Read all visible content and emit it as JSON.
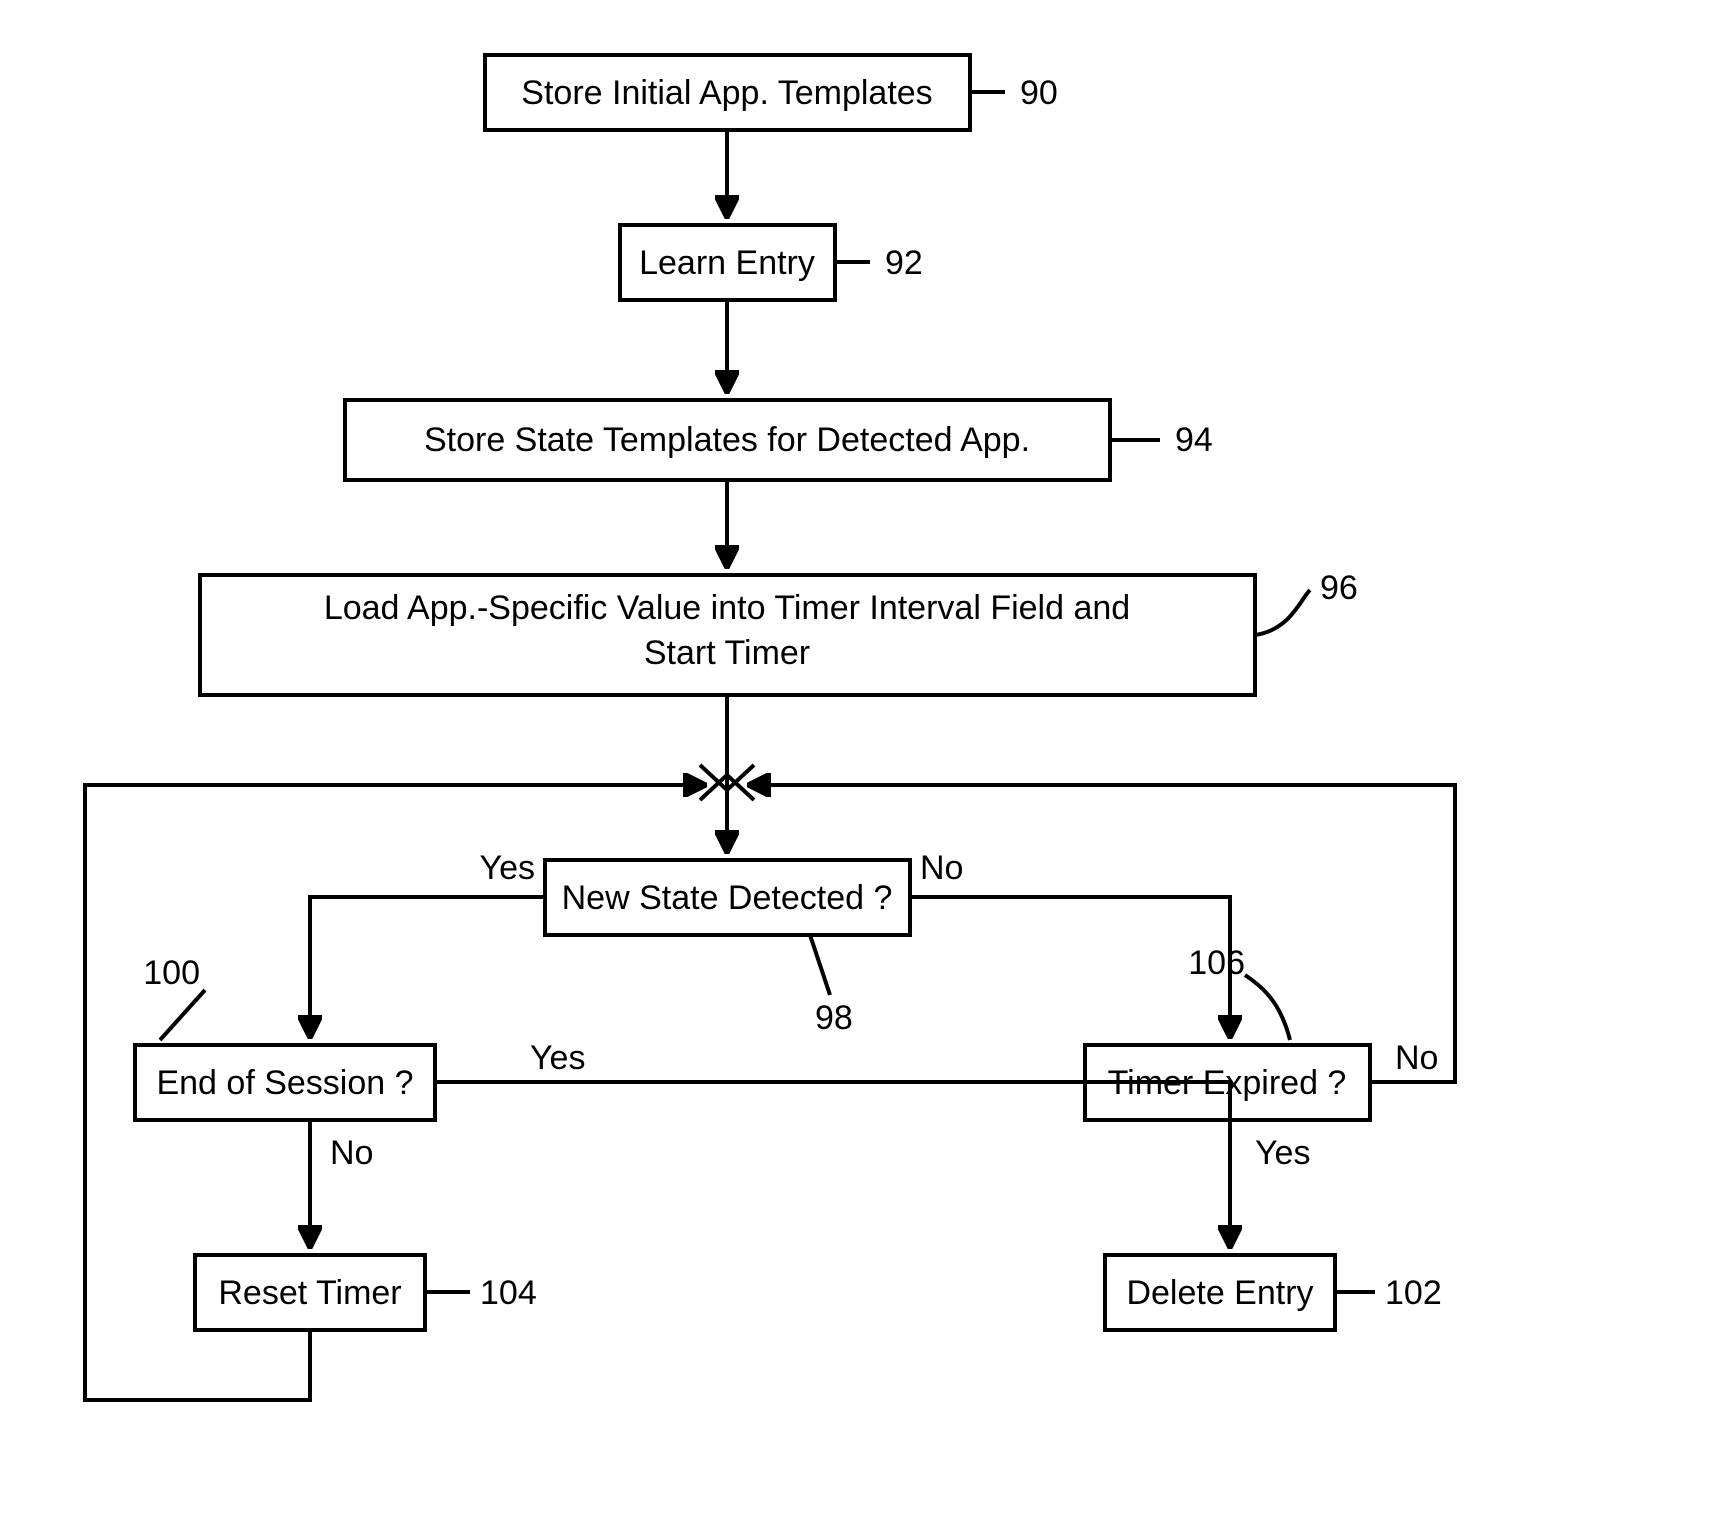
{
  "flowchart": {
    "boxes": {
      "b90": {
        "label": "Store Initial App. Templates",
        "ref": "90"
      },
      "b92": {
        "label": "Learn Entry",
        "ref": "92"
      },
      "b94": {
        "label": "Store State Templates for Detected App.",
        "ref": "94"
      },
      "b96": {
        "line1": "Load App.-Specific Value into Timer Interval Field and",
        "line2": "Start Timer",
        "ref": "96"
      },
      "b98": {
        "label": "New State Detected ?",
        "ref": "98"
      },
      "b100": {
        "label": "End of Session ?",
        "ref": "100"
      },
      "b102": {
        "label": "Delete Entry",
        "ref": "102"
      },
      "b104": {
        "label": "Reset Timer",
        "ref": "104"
      },
      "b106": {
        "label": "Timer Expired ?",
        "ref": "106"
      }
    },
    "edge_labels": {
      "yes1": "Yes",
      "no1": "No",
      "yes2": "Yes",
      "no2": "No",
      "yes3": "Yes",
      "no3": "No"
    }
  }
}
